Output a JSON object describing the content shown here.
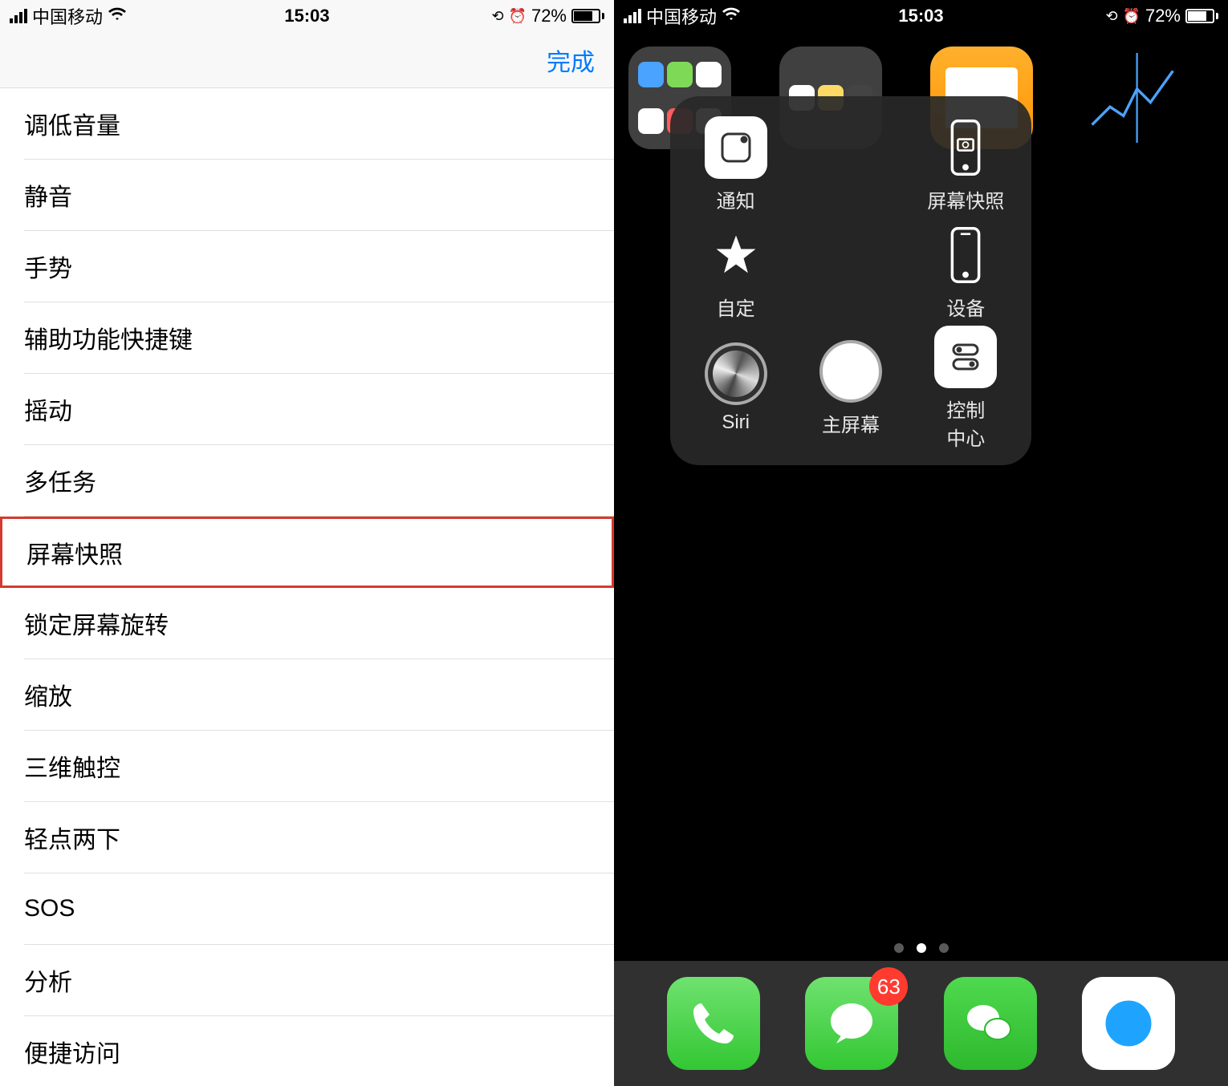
{
  "statusbar": {
    "carrier": "中国移动",
    "time": "15:03",
    "battery_pct": "72%"
  },
  "left": {
    "done_label": "完成",
    "items": [
      {
        "label": "调低音量"
      },
      {
        "label": "静音"
      },
      {
        "label": "手势"
      },
      {
        "label": "辅助功能快捷键"
      },
      {
        "label": "摇动"
      },
      {
        "label": "多任务"
      },
      {
        "label": "屏幕快照",
        "highlighted": true
      },
      {
        "label": "锁定屏幕旋转"
      },
      {
        "label": "缩放"
      },
      {
        "label": "三维触控"
      },
      {
        "label": "轻点两下"
      },
      {
        "label": "SOS"
      },
      {
        "label": "分析"
      },
      {
        "label": "便捷访问"
      }
    ]
  },
  "right": {
    "assistive_touch": {
      "notification": "通知",
      "screenshot": "屏幕快照",
      "custom": "自定",
      "device": "设备",
      "siri": "Siri",
      "home": "主屏幕",
      "control_center": "控制\n中心"
    },
    "dock": {
      "messages_badge": "63"
    },
    "page_dots": {
      "count": 3,
      "active": 1
    }
  }
}
